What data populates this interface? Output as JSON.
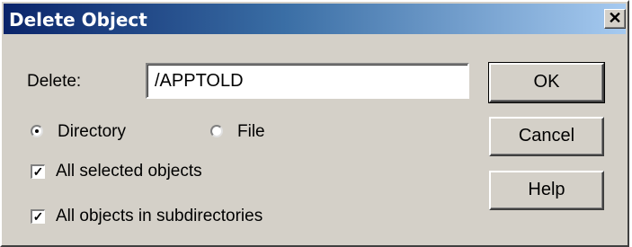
{
  "window": {
    "title": "Delete Object",
    "close_label": "✕"
  },
  "form": {
    "delete_label": "Delete:",
    "delete_value": "/APPTOLD",
    "radio_directory_label": "Directory",
    "radio_file_label": "File",
    "selected_type": "Directory",
    "checkbox_all_selected_label": "All selected objects",
    "checkbox_all_selected_checked": true,
    "checkbox_subdirs_label": "All objects in subdirectories",
    "checkbox_subdirs_checked": true
  },
  "buttons": {
    "ok": "OK",
    "cancel": "Cancel",
    "help": "Help"
  }
}
